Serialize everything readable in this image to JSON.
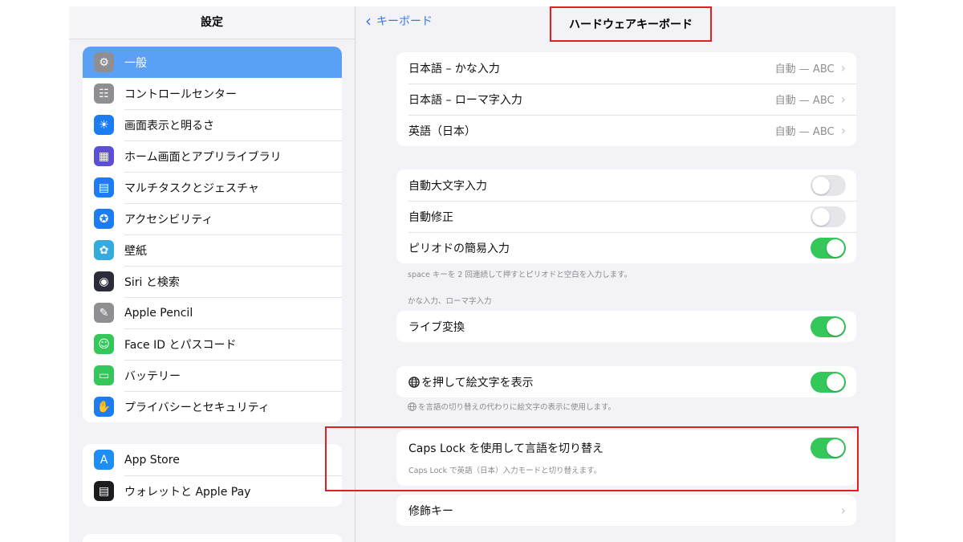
{
  "sidebar": {
    "title": "設定",
    "items": [
      {
        "label": "一般",
        "color": "#8e8e93",
        "icon": "gear-icon",
        "glyph": "⚙"
      },
      {
        "label": "コントロールセンター",
        "color": "#8e8e93",
        "icon": "toggles-icon",
        "glyph": "☷"
      },
      {
        "label": "画面表示と明るさ",
        "color": "#1e7cf2",
        "icon": "sun-icon",
        "glyph": "☀"
      },
      {
        "label": "ホーム画面とアプリライブラリ",
        "color": "#5b4fd6",
        "icon": "app-grid-icon",
        "glyph": "▦"
      },
      {
        "label": "マルチタスクとジェスチャ",
        "color": "#1e7cf2",
        "icon": "multitask-icon",
        "glyph": "▤"
      },
      {
        "label": "アクセシビリティ",
        "color": "#1e7cf2",
        "icon": "accessibility-icon",
        "glyph": "✪"
      },
      {
        "label": "壁紙",
        "color": "#35aadc",
        "icon": "flower-icon",
        "glyph": "✿"
      },
      {
        "label": "Siri と検索",
        "color": "#2b2b3a",
        "icon": "siri-icon",
        "glyph": "◉"
      },
      {
        "label": "Apple Pencil",
        "color": "#8e8e93",
        "icon": "pencil-icon",
        "glyph": "✎"
      },
      {
        "label": "Face ID とパスコード",
        "color": "#34c759",
        "icon": "face-id-icon",
        "glyph": "☺"
      },
      {
        "label": "バッテリー",
        "color": "#34c759",
        "icon": "battery-icon",
        "glyph": "▭"
      },
      {
        "label": "プライバシーとセキュリティ",
        "color": "#1e7cf2",
        "icon": "hand-icon",
        "glyph": "✋"
      }
    ],
    "items2": [
      {
        "label": "App Store",
        "color": "#1e8ef5",
        "icon": "app-store-icon",
        "glyph": "A"
      },
      {
        "label": "ウォレットと Apple Pay",
        "color": "#1c1c1e",
        "icon": "wallet-icon",
        "glyph": "▤"
      }
    ]
  },
  "detail": {
    "back_label": "キーボード",
    "title": "ハードウェアキーボード",
    "languages": [
      {
        "label": "日本語 – かな入力",
        "value": "自動 — ABC"
      },
      {
        "label": "日本語 – ローマ字入力",
        "value": "自動 — ABC"
      },
      {
        "label": "英語（日本）",
        "value": "自動 — ABC"
      }
    ],
    "general_toggles": [
      {
        "label": "自動大文字入力",
        "on": false
      },
      {
        "label": "自動修正",
        "on": false
      },
      {
        "label": "ピリオドの簡易入力",
        "on": true
      }
    ],
    "period_footnote": "space キーを 2 回連続して押すとピリオドと空白を入力します。",
    "kana_header": "かな入力、ローマ字入力",
    "live_conversion": {
      "label": "ライブ変換",
      "on": true
    },
    "emoji_toggle": {
      "label": "を押して絵文字を表示",
      "on": true
    },
    "emoji_footnote": "を言語の切り替えの代わりに絵文字の表示に使用します。",
    "caps_lock": {
      "label": "Caps Lock を使用して言語を切り替え",
      "on": true,
      "footnote": "Caps Lock で英語（日本）入力モードと切り替えます。"
    },
    "modifier_keys": {
      "label": "修飾キー"
    }
  },
  "colors": {
    "accent": "#3478f6",
    "toggle_on": "#34c759",
    "highlight": "#e02020",
    "selected": "#5aa0f5"
  }
}
